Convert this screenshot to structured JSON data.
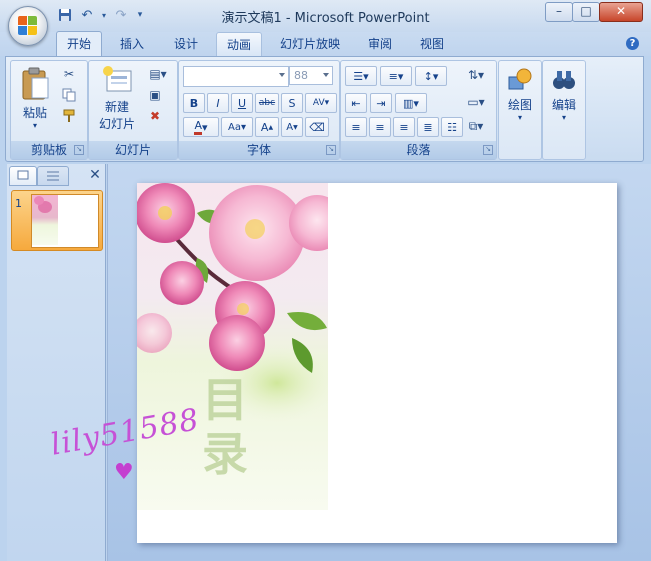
{
  "window": {
    "title": "演示文稿1 - Microsoft PowerPoint",
    "minimize_glyph": "–",
    "maximize_glyph": "□",
    "close_glyph": "✕"
  },
  "tabs": [
    "开始",
    "插入",
    "设计",
    "动画",
    "幻灯片放映",
    "审阅",
    "视图"
  ],
  "active_tab": "开始",
  "hovered_tab": "动画",
  "ribbon": {
    "clipboard": {
      "label": "剪贴板",
      "paste_label": "粘贴"
    },
    "slides": {
      "label": "幻灯片",
      "new_slide_line1": "新建",
      "new_slide_line2": "幻灯片"
    },
    "font": {
      "label": "字体",
      "font_name_value": "",
      "font_size_value": "88"
    },
    "paragraph": {
      "label": "段落"
    },
    "drawing": {
      "label": "绘图"
    },
    "editing": {
      "label": "编辑"
    }
  },
  "slide_pane": {
    "slide_number": "1"
  },
  "slide": {
    "caption": "目录"
  },
  "watermark": {
    "text": "lily51588"
  },
  "colors": {
    "accent": "#15428b",
    "thumbnail_selected": "#f6a93d",
    "slide_bg": "#ffffff"
  }
}
